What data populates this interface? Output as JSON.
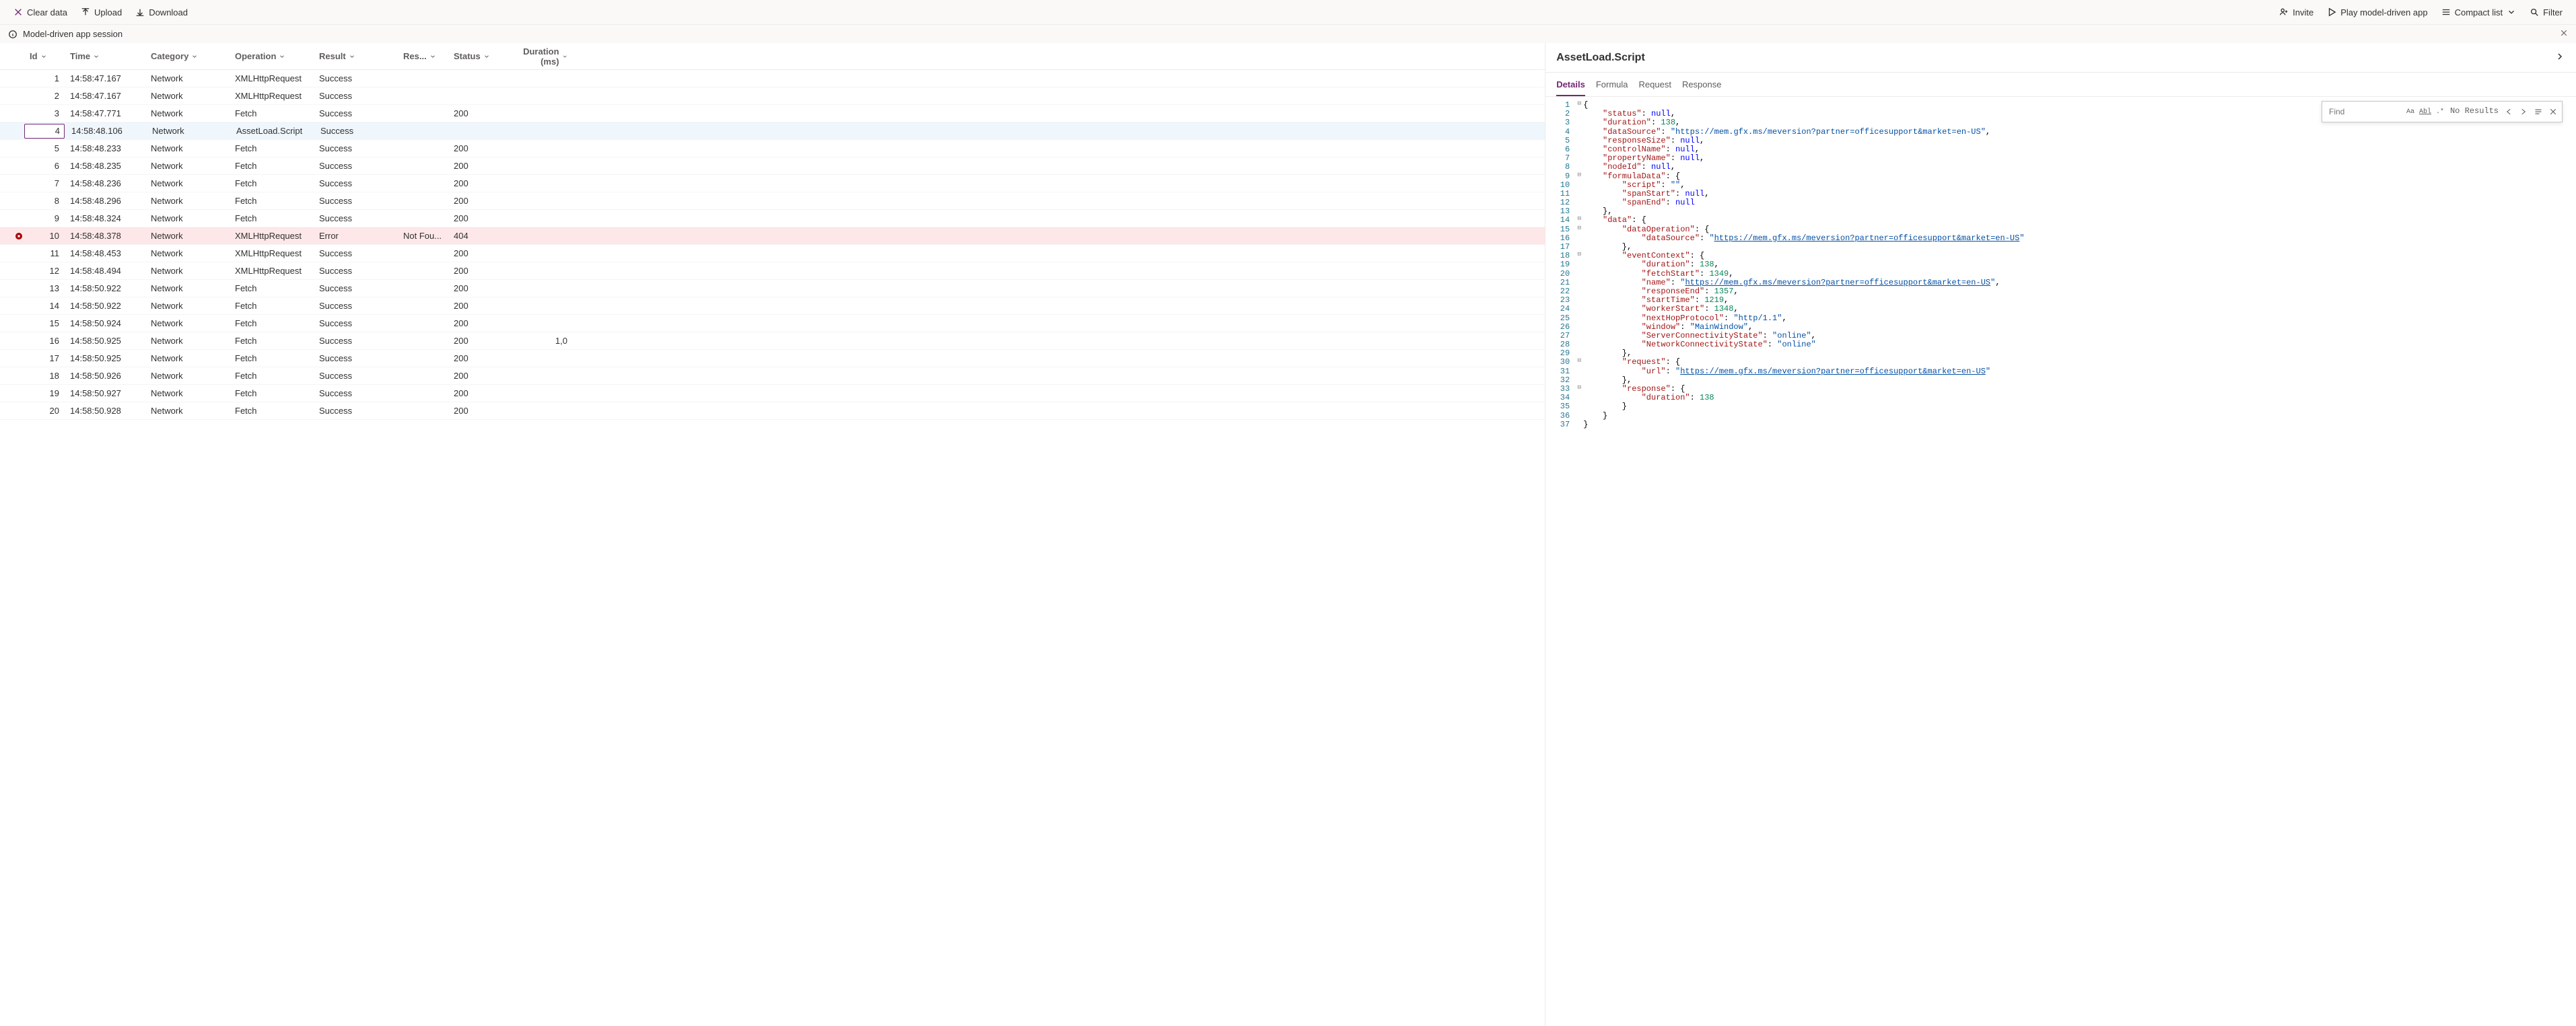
{
  "toolbar": {
    "clear": "Clear data",
    "upload": "Upload",
    "download": "Download",
    "invite": "Invite",
    "play": "Play model-driven app",
    "compact": "Compact list",
    "filter": "Filter"
  },
  "session": {
    "title": "Model-driven app session"
  },
  "columns": {
    "id": "Id",
    "time": "Time",
    "category": "Category",
    "operation": "Operation",
    "result": "Result",
    "response": "Res...",
    "status": "Status",
    "duration": "Duration (ms)"
  },
  "rows": [
    {
      "id": "1",
      "time": "14:58:47.167",
      "cat": "Network",
      "op": "XMLHttpRequest",
      "res": "Success",
      "resp": "",
      "stat": "",
      "dur": ""
    },
    {
      "id": "2",
      "time": "14:58:47.167",
      "cat": "Network",
      "op": "XMLHttpRequest",
      "res": "Success",
      "resp": "",
      "stat": "",
      "dur": ""
    },
    {
      "id": "3",
      "time": "14:58:47.771",
      "cat": "Network",
      "op": "Fetch",
      "res": "Success",
      "resp": "",
      "stat": "200",
      "dur": ""
    },
    {
      "id": "4",
      "time": "14:58:48.106",
      "cat": "Network",
      "op": "AssetLoad.Script",
      "res": "Success",
      "resp": "",
      "stat": "",
      "dur": "",
      "selected": true
    },
    {
      "id": "5",
      "time": "14:58:48.233",
      "cat": "Network",
      "op": "Fetch",
      "res": "Success",
      "resp": "",
      "stat": "200",
      "dur": ""
    },
    {
      "id": "6",
      "time": "14:58:48.235",
      "cat": "Network",
      "op": "Fetch",
      "res": "Success",
      "resp": "",
      "stat": "200",
      "dur": ""
    },
    {
      "id": "7",
      "time": "14:58:48.236",
      "cat": "Network",
      "op": "Fetch",
      "res": "Success",
      "resp": "",
      "stat": "200",
      "dur": ""
    },
    {
      "id": "8",
      "time": "14:58:48.296",
      "cat": "Network",
      "op": "Fetch",
      "res": "Success",
      "resp": "",
      "stat": "200",
      "dur": ""
    },
    {
      "id": "9",
      "time": "14:58:48.324",
      "cat": "Network",
      "op": "Fetch",
      "res": "Success",
      "resp": "",
      "stat": "200",
      "dur": ""
    },
    {
      "id": "10",
      "time": "14:58:48.378",
      "cat": "Network",
      "op": "XMLHttpRequest",
      "res": "Error",
      "resp": "Not Fou...",
      "stat": "404",
      "dur": "",
      "error": true
    },
    {
      "id": "11",
      "time": "14:58:48.453",
      "cat": "Network",
      "op": "XMLHttpRequest",
      "res": "Success",
      "resp": "",
      "stat": "200",
      "dur": ""
    },
    {
      "id": "12",
      "time": "14:58:48.494",
      "cat": "Network",
      "op": "XMLHttpRequest",
      "res": "Success",
      "resp": "",
      "stat": "200",
      "dur": ""
    },
    {
      "id": "13",
      "time": "14:58:50.922",
      "cat": "Network",
      "op": "Fetch",
      "res": "Success",
      "resp": "",
      "stat": "200",
      "dur": ""
    },
    {
      "id": "14",
      "time": "14:58:50.922",
      "cat": "Network",
      "op": "Fetch",
      "res": "Success",
      "resp": "",
      "stat": "200",
      "dur": ""
    },
    {
      "id": "15",
      "time": "14:58:50.924",
      "cat": "Network",
      "op": "Fetch",
      "res": "Success",
      "resp": "",
      "stat": "200",
      "dur": ""
    },
    {
      "id": "16",
      "time": "14:58:50.925",
      "cat": "Network",
      "op": "Fetch",
      "res": "Success",
      "resp": "",
      "stat": "200",
      "dur": "1,0"
    },
    {
      "id": "17",
      "time": "14:58:50.925",
      "cat": "Network",
      "op": "Fetch",
      "res": "Success",
      "resp": "",
      "stat": "200",
      "dur": ""
    },
    {
      "id": "18",
      "time": "14:58:50.926",
      "cat": "Network",
      "op": "Fetch",
      "res": "Success",
      "resp": "",
      "stat": "200",
      "dur": ""
    },
    {
      "id": "19",
      "time": "14:58:50.927",
      "cat": "Network",
      "op": "Fetch",
      "res": "Success",
      "resp": "",
      "stat": "200",
      "dur": ""
    },
    {
      "id": "20",
      "time": "14:58:50.928",
      "cat": "Network",
      "op": "Fetch",
      "res": "Success",
      "resp": "",
      "stat": "200",
      "dur": ""
    }
  ],
  "detail": {
    "title": "AssetLoad.Script",
    "tabs": [
      "Details",
      "Formula",
      "Request",
      "Response"
    ],
    "find_placeholder": "Find",
    "find_result": "No Results"
  },
  "code": {
    "url": "https://mem.gfx.ms/meversion?partner=officesupport&market=en-US",
    "lines": [
      {
        "n": 1,
        "fold": "−",
        "t": [
          [
            "punc",
            "{"
          ]
        ]
      },
      {
        "n": 2,
        "t": [
          [
            "pad",
            "    "
          ],
          [
            "key",
            "\"status\""
          ],
          [
            "punc",
            ": "
          ],
          [
            "kw",
            "null"
          ],
          [
            "punc",
            ","
          ]
        ]
      },
      {
        "n": 3,
        "t": [
          [
            "pad",
            "    "
          ],
          [
            "key",
            "\"duration\""
          ],
          [
            "punc",
            ": "
          ],
          [
            "num",
            "138"
          ],
          [
            "punc",
            ","
          ]
        ]
      },
      {
        "n": 4,
        "t": [
          [
            "pad",
            "    "
          ],
          [
            "key",
            "\"dataSource\""
          ],
          [
            "punc",
            ": "
          ],
          [
            "str",
            "\"https://mem.gfx.ms/meversion?partner=officesupport&market=en-US\""
          ],
          [
            "punc",
            ","
          ]
        ]
      },
      {
        "n": 5,
        "t": [
          [
            "pad",
            "    "
          ],
          [
            "key",
            "\"responseSize\""
          ],
          [
            "punc",
            ": "
          ],
          [
            "kw",
            "null"
          ],
          [
            "punc",
            ","
          ]
        ]
      },
      {
        "n": 6,
        "t": [
          [
            "pad",
            "    "
          ],
          [
            "key",
            "\"controlName\""
          ],
          [
            "punc",
            ": "
          ],
          [
            "kw",
            "null"
          ],
          [
            "punc",
            ","
          ]
        ]
      },
      {
        "n": 7,
        "t": [
          [
            "pad",
            "    "
          ],
          [
            "key",
            "\"propertyName\""
          ],
          [
            "punc",
            ": "
          ],
          [
            "kw",
            "null"
          ],
          [
            "punc",
            ","
          ]
        ]
      },
      {
        "n": 8,
        "t": [
          [
            "pad",
            "    "
          ],
          [
            "key",
            "\"nodeId\""
          ],
          [
            "punc",
            ": "
          ],
          [
            "kw",
            "null"
          ],
          [
            "punc",
            ","
          ]
        ]
      },
      {
        "n": 9,
        "fold": "−",
        "t": [
          [
            "pad",
            "    "
          ],
          [
            "key",
            "\"formulaData\""
          ],
          [
            "punc",
            ": {"
          ]
        ]
      },
      {
        "n": 10,
        "t": [
          [
            "pad",
            "        "
          ],
          [
            "key",
            "\"script\""
          ],
          [
            "punc",
            ": "
          ],
          [
            "str",
            "\"\""
          ],
          [
            "punc",
            ","
          ]
        ]
      },
      {
        "n": 11,
        "t": [
          [
            "pad",
            "        "
          ],
          [
            "key",
            "\"spanStart\""
          ],
          [
            "punc",
            ": "
          ],
          [
            "kw",
            "null"
          ],
          [
            "punc",
            ","
          ]
        ]
      },
      {
        "n": 12,
        "t": [
          [
            "pad",
            "        "
          ],
          [
            "key",
            "\"spanEnd\""
          ],
          [
            "punc",
            ": "
          ],
          [
            "kw",
            "null"
          ]
        ]
      },
      {
        "n": 13,
        "t": [
          [
            "pad",
            "    "
          ],
          [
            "punc",
            "},"
          ]
        ]
      },
      {
        "n": 14,
        "fold": "−",
        "t": [
          [
            "pad",
            "    "
          ],
          [
            "key",
            "\"data\""
          ],
          [
            "punc",
            ": {"
          ]
        ]
      },
      {
        "n": 15,
        "fold": "−",
        "t": [
          [
            "pad",
            "        "
          ],
          [
            "key",
            "\"dataOperation\""
          ],
          [
            "punc",
            ": {"
          ]
        ]
      },
      {
        "n": 16,
        "t": [
          [
            "pad",
            "            "
          ],
          [
            "key",
            "\"dataSource\""
          ],
          [
            "punc",
            ": "
          ],
          [
            "str",
            "\""
          ],
          [
            "url",
            "https://mem.gfx.ms/meversion?partner=officesupport&market=en-US"
          ],
          [
            "str",
            "\""
          ]
        ]
      },
      {
        "n": 17,
        "t": [
          [
            "pad",
            "        "
          ],
          [
            "punc",
            "},"
          ]
        ]
      },
      {
        "n": 18,
        "fold": "−",
        "t": [
          [
            "pad",
            "        "
          ],
          [
            "key",
            "\"eventContext\""
          ],
          [
            "punc",
            ": {"
          ]
        ]
      },
      {
        "n": 19,
        "t": [
          [
            "pad",
            "            "
          ],
          [
            "key",
            "\"duration\""
          ],
          [
            "punc",
            ": "
          ],
          [
            "num",
            "138"
          ],
          [
            "punc",
            ","
          ]
        ]
      },
      {
        "n": 20,
        "t": [
          [
            "pad",
            "            "
          ],
          [
            "key",
            "\"fetchStart\""
          ],
          [
            "punc",
            ": "
          ],
          [
            "num",
            "1349"
          ],
          [
            "punc",
            ","
          ]
        ]
      },
      {
        "n": 21,
        "t": [
          [
            "pad",
            "            "
          ],
          [
            "key",
            "\"name\""
          ],
          [
            "punc",
            ": "
          ],
          [
            "str",
            "\""
          ],
          [
            "url",
            "https://mem.gfx.ms/meversion?partner=officesupport&market=en-US"
          ],
          [
            "str",
            "\""
          ],
          [
            "punc",
            ","
          ]
        ]
      },
      {
        "n": 22,
        "t": [
          [
            "pad",
            "            "
          ],
          [
            "key",
            "\"responseEnd\""
          ],
          [
            "punc",
            ": "
          ],
          [
            "num",
            "1357"
          ],
          [
            "punc",
            ","
          ]
        ]
      },
      {
        "n": 23,
        "t": [
          [
            "pad",
            "            "
          ],
          [
            "key",
            "\"startTime\""
          ],
          [
            "punc",
            ": "
          ],
          [
            "num",
            "1219"
          ],
          [
            "punc",
            ","
          ]
        ]
      },
      {
        "n": 24,
        "t": [
          [
            "pad",
            "            "
          ],
          [
            "key",
            "\"workerStart\""
          ],
          [
            "punc",
            ": "
          ],
          [
            "num",
            "1348"
          ],
          [
            "punc",
            ","
          ]
        ]
      },
      {
        "n": 25,
        "t": [
          [
            "pad",
            "            "
          ],
          [
            "key",
            "\"nextHopProtocol\""
          ],
          [
            "punc",
            ": "
          ],
          [
            "str",
            "\"http/1.1\""
          ],
          [
            "punc",
            ","
          ]
        ]
      },
      {
        "n": 26,
        "t": [
          [
            "pad",
            "            "
          ],
          [
            "key",
            "\"window\""
          ],
          [
            "punc",
            ": "
          ],
          [
            "str",
            "\"MainWindow\""
          ],
          [
            "punc",
            ","
          ]
        ]
      },
      {
        "n": 27,
        "t": [
          [
            "pad",
            "            "
          ],
          [
            "key",
            "\"ServerConnectivityState\""
          ],
          [
            "punc",
            ": "
          ],
          [
            "str",
            "\"online\""
          ],
          [
            "punc",
            ","
          ]
        ]
      },
      {
        "n": 28,
        "t": [
          [
            "pad",
            "            "
          ],
          [
            "key",
            "\"NetworkConnectivityState\""
          ],
          [
            "punc",
            ": "
          ],
          [
            "str",
            "\"online\""
          ]
        ]
      },
      {
        "n": 29,
        "t": [
          [
            "pad",
            "        "
          ],
          [
            "punc",
            "},"
          ]
        ]
      },
      {
        "n": 30,
        "fold": "−",
        "t": [
          [
            "pad",
            "        "
          ],
          [
            "key",
            "\"request\""
          ],
          [
            "punc",
            ": {"
          ]
        ]
      },
      {
        "n": 31,
        "t": [
          [
            "pad",
            "            "
          ],
          [
            "key",
            "\"url\""
          ],
          [
            "punc",
            ": "
          ],
          [
            "str",
            "\""
          ],
          [
            "url",
            "https://mem.gfx.ms/meversion?partner=officesupport&market=en-US"
          ],
          [
            "str",
            "\""
          ]
        ]
      },
      {
        "n": 32,
        "t": [
          [
            "pad",
            "        "
          ],
          [
            "punc",
            "},"
          ]
        ]
      },
      {
        "n": 33,
        "fold": "−",
        "t": [
          [
            "pad",
            "        "
          ],
          [
            "key",
            "\"response\""
          ],
          [
            "punc",
            ": {"
          ]
        ]
      },
      {
        "n": 34,
        "t": [
          [
            "pad",
            "            "
          ],
          [
            "key",
            "\"duration\""
          ],
          [
            "punc",
            ": "
          ],
          [
            "num",
            "138"
          ]
        ]
      },
      {
        "n": 35,
        "t": [
          [
            "pad",
            "        "
          ],
          [
            "punc",
            "}"
          ]
        ]
      },
      {
        "n": 36,
        "t": [
          [
            "pad",
            "    "
          ],
          [
            "punc",
            "}"
          ]
        ]
      },
      {
        "n": 37,
        "t": [
          [
            "punc",
            "}"
          ]
        ]
      }
    ]
  }
}
